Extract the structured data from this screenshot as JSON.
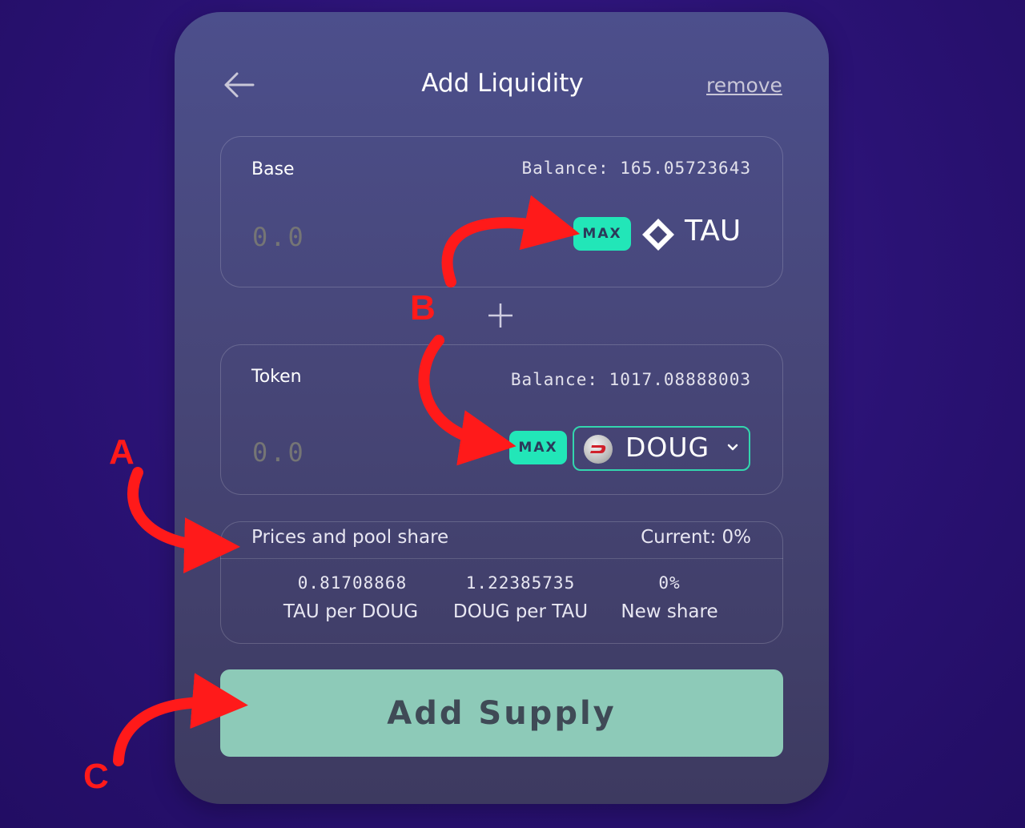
{
  "header": {
    "title": "Add Liquidity",
    "remove_label": "remove"
  },
  "base": {
    "label": "Base",
    "balance": "Balance: 165.05723643",
    "amount_placeholder": "0.0",
    "max_label": "MAX",
    "token_name": "TAU"
  },
  "token": {
    "label": "Token",
    "balance": "Balance: 1017.08888003",
    "amount_placeholder": "0.0",
    "max_label": "MAX",
    "token_name": "DOUG"
  },
  "prices": {
    "title": "Prices and pool share",
    "current": "Current: 0%",
    "items": [
      {
        "value": "0.81708868",
        "label": "TAU per DOUG"
      },
      {
        "value": "1.22385735",
        "label": "DOUG per TAU"
      },
      {
        "value": "0%",
        "label": "New share"
      }
    ]
  },
  "submit_label": "Add Supply",
  "annotations": {
    "a": "A",
    "b": "B",
    "c": "C"
  },
  "colors": {
    "accent": "#22e6b8",
    "button": "#8dcab8",
    "annotation": "#ff1a1a"
  }
}
